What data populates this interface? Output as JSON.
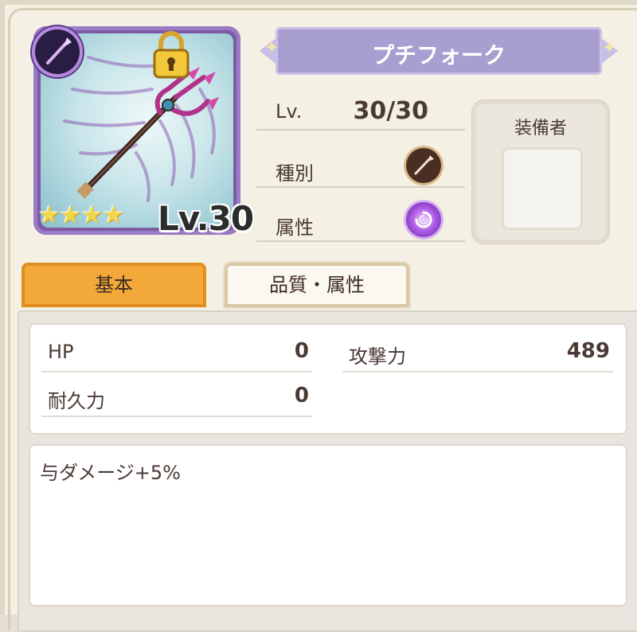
{
  "item": {
    "name": "プチフォーク",
    "card_level": "Lv.30",
    "rarity_stars": 4,
    "star_glyph": "★"
  },
  "info": {
    "level_label": "Lv.",
    "level_value": "30/30",
    "type_label": "種別",
    "type_icon": "spear-icon",
    "attribute_label": "属性",
    "attribute_icon": "dark-swirl-icon"
  },
  "equipper": {
    "label": "装備者"
  },
  "tabs": [
    {
      "label": "基本",
      "active": true
    },
    {
      "label": "品質・属性",
      "active": false
    }
  ],
  "stats": {
    "hp_label": "HP",
    "hp_value": "0",
    "attack_label": "攻撃力",
    "attack_value": "489",
    "durability_label": "耐久力",
    "durability_value": "0"
  },
  "description": "与ダメージ+5%",
  "colors": {
    "tab_active": "#f2a93a",
    "banner": "#a89fd0",
    "card_frame": "#7b5aa6",
    "star": "#f3d548"
  }
}
